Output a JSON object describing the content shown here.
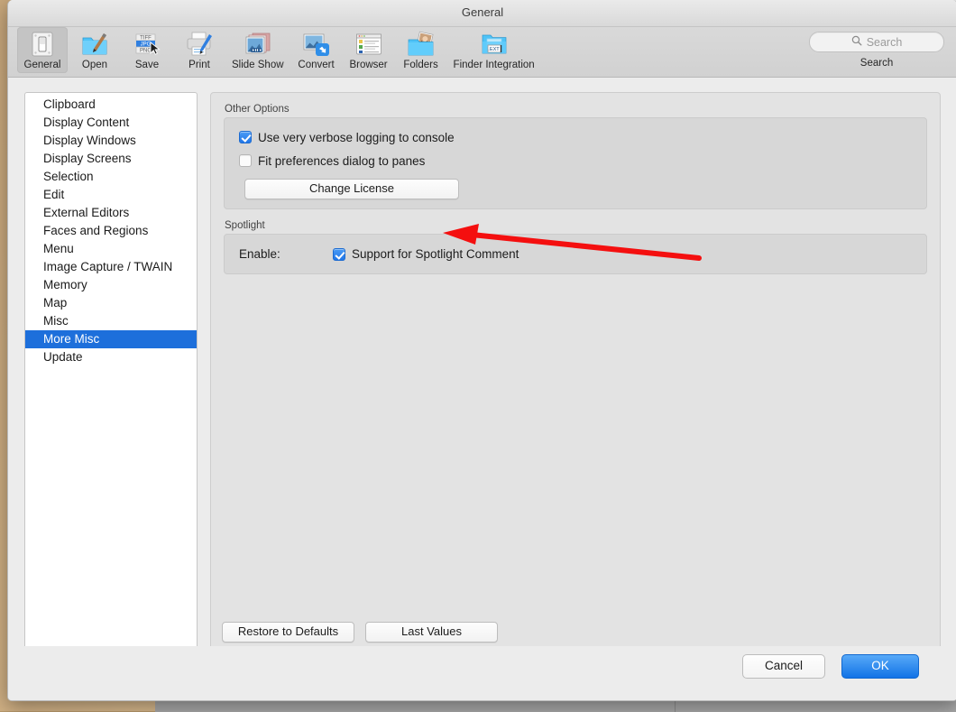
{
  "window": {
    "title": "General"
  },
  "toolbar": {
    "items": [
      {
        "label": "General",
        "icon": "switch-icon",
        "selected": true
      },
      {
        "label": "Open",
        "icon": "folder-brush-icon",
        "selected": false
      },
      {
        "label": "Save",
        "icon": "formats-tiff-jpg-png-icon",
        "selected": false
      },
      {
        "label": "Print",
        "icon": "printer-icon",
        "selected": false
      },
      {
        "label": "Slide Show",
        "icon": "slideshow-icon",
        "selected": false
      },
      {
        "label": "Convert",
        "icon": "convert-arrow-icon",
        "selected": false
      },
      {
        "label": "Browser",
        "icon": "browser-list-icon",
        "selected": false
      },
      {
        "label": "Folders",
        "icon": "folder-photo-icon",
        "selected": false
      },
      {
        "label": "Finder Integration",
        "icon": "folder-ext-icon",
        "selected": false
      }
    ]
  },
  "search": {
    "placeholder": "Search",
    "value": "",
    "caption": "Search",
    "icon": "search-icon"
  },
  "sidebar": {
    "items": [
      {
        "label": "Clipboard",
        "selected": false
      },
      {
        "label": "Display Content",
        "selected": false
      },
      {
        "label": "Display Windows",
        "selected": false
      },
      {
        "label": "Display Screens",
        "selected": false
      },
      {
        "label": "Selection",
        "selected": false
      },
      {
        "label": "Edit",
        "selected": false
      },
      {
        "label": "External Editors",
        "selected": false
      },
      {
        "label": "Faces and Regions",
        "selected": false
      },
      {
        "label": "Menu",
        "selected": false
      },
      {
        "label": "Image Capture / TWAIN",
        "selected": false
      },
      {
        "label": "Memory",
        "selected": false
      },
      {
        "label": "Map",
        "selected": false
      },
      {
        "label": "Misc",
        "selected": false
      },
      {
        "label": "More Misc",
        "selected": true
      },
      {
        "label": "Update",
        "selected": false
      }
    ]
  },
  "main": {
    "other_options": {
      "group_label": "Other Options",
      "checkboxes": [
        {
          "label": "Use very verbose logging to console",
          "checked": true
        },
        {
          "label": "Fit preferences dialog to panes",
          "checked": false
        }
      ],
      "change_license_label": "Change License"
    },
    "spotlight": {
      "group_label": "Spotlight",
      "enable_label": "Enable:",
      "checkbox": {
        "label": "Support for Spotlight Comment",
        "checked": true
      }
    },
    "restore_defaults_label": "Restore to Defaults",
    "last_values_label": "Last Values"
  },
  "footer": {
    "cancel_label": "Cancel",
    "ok_label": "OK"
  },
  "annotation": {
    "arrow_color": "#f40f0f",
    "points_to": "Fit preferences dialog to panes"
  },
  "colors": {
    "selection_blue": "#1d6fdb",
    "accent_blue": "#1273e6",
    "checkbox_blue": "#2076e8",
    "window_bg": "#ececec",
    "pane_bg": "#e3e3e3",
    "group_bg": "#d7d7d7",
    "sidebar_bg": "#ffffff",
    "desktop": "#c9a87c"
  }
}
